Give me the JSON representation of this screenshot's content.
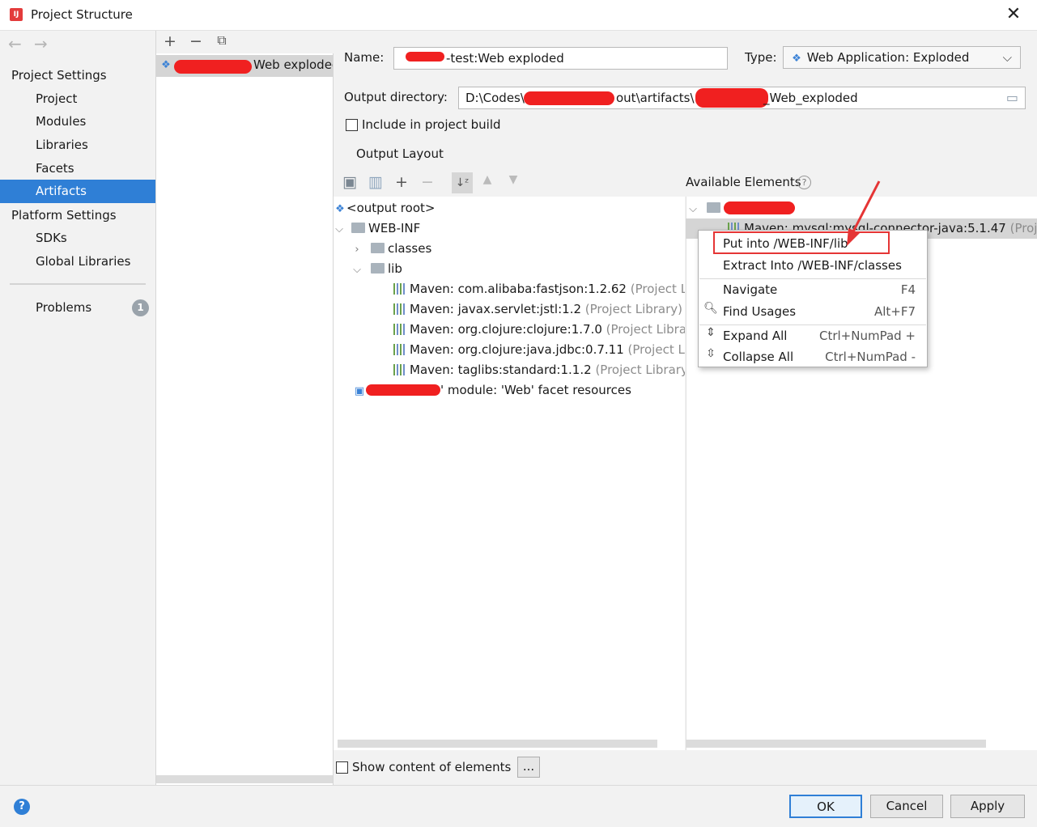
{
  "window": {
    "title": "Project Structure",
    "close_glyph": "✕"
  },
  "nav": {
    "back_icon": "arrow-left-icon",
    "forward_icon": "arrow-right-icon",
    "project_settings_header": "Project Settings",
    "project_items": [
      "Project",
      "Modules",
      "Libraries",
      "Facets",
      "Artifacts"
    ],
    "selected": "Artifacts",
    "platform_settings_header": "Platform Settings",
    "platform_items": [
      "SDKs",
      "Global Libraries"
    ],
    "problems_label": "Problems",
    "problems_count": "1"
  },
  "artifact_list": {
    "toolbar": [
      "add-icon",
      "remove-icon",
      "copy-icon"
    ],
    "item_suffix": "Web exploded"
  },
  "artifact": {
    "name_label": "Name:",
    "name_value_suffix": "-test:Web exploded",
    "type_label": "Type:",
    "type_value": "Web Application: Exploded",
    "output_dir_label": "Output directory:",
    "output_dir_part1": "D:\\Codes\\",
    "output_dir_part2": "out\\artifacts\\",
    "output_dir_part3": "_Web_exploded",
    "include_label": "Include in project build",
    "include_checked": false,
    "output_layout_tab": "Output Layout"
  },
  "layout_tree": {
    "rows": [
      {
        "text": "<output root>",
        "suffix": ""
      },
      {
        "text": "WEB-INF",
        "suffix": ""
      },
      {
        "text": "classes",
        "suffix": ""
      },
      {
        "text": "lib",
        "suffix": ""
      },
      {
        "text": "Maven: com.alibaba:fastjson:1.2.62",
        "suffix": "(Project Lib"
      },
      {
        "text": "Maven: javax.servlet:jstl:1.2",
        "suffix": "(Project Library)"
      },
      {
        "text": "Maven: org.clojure:clojure:1.7.0",
        "suffix": "(Project Library"
      },
      {
        "text": "Maven: org.clojure:java.jdbc:0.7.11",
        "suffix": "(Project Lib"
      },
      {
        "text": "Maven: taglibs:standard:1.1.2",
        "suffix": "(Project Library)"
      },
      {
        "text": "' module: 'Web' facet resources",
        "suffix": ""
      }
    ]
  },
  "available": {
    "header": "Available Elements",
    "help_glyph": "?",
    "selected_row_text": "Maven: mysql:mysql-connector-java:5.1.47",
    "selected_row_suffix": "(Proje"
  },
  "context_menu": {
    "items": [
      {
        "label": "Put into /WEB-INF/lib",
        "shortcut": ""
      },
      {
        "label": "Extract Into /WEB-INF/classes",
        "shortcut": ""
      },
      {
        "label": "Navigate",
        "shortcut": "F4"
      },
      {
        "label": "Find Usages",
        "shortcut": "Alt+F7"
      },
      {
        "label": "Expand All",
        "shortcut": "Ctrl+NumPad +"
      },
      {
        "label": "Collapse All",
        "shortcut": "Ctrl+NumPad -"
      }
    ]
  },
  "footer": {
    "show_content_label": "Show content of elements",
    "dots_label": "...",
    "ok_label": "OK",
    "cancel_label": "Cancel",
    "apply_label": "Apply",
    "help_glyph": "?"
  },
  "colors": {
    "selection_blue": "#2f7fd6",
    "annotation_red": "#e53535",
    "panel_bg": "#f2f2f2"
  }
}
